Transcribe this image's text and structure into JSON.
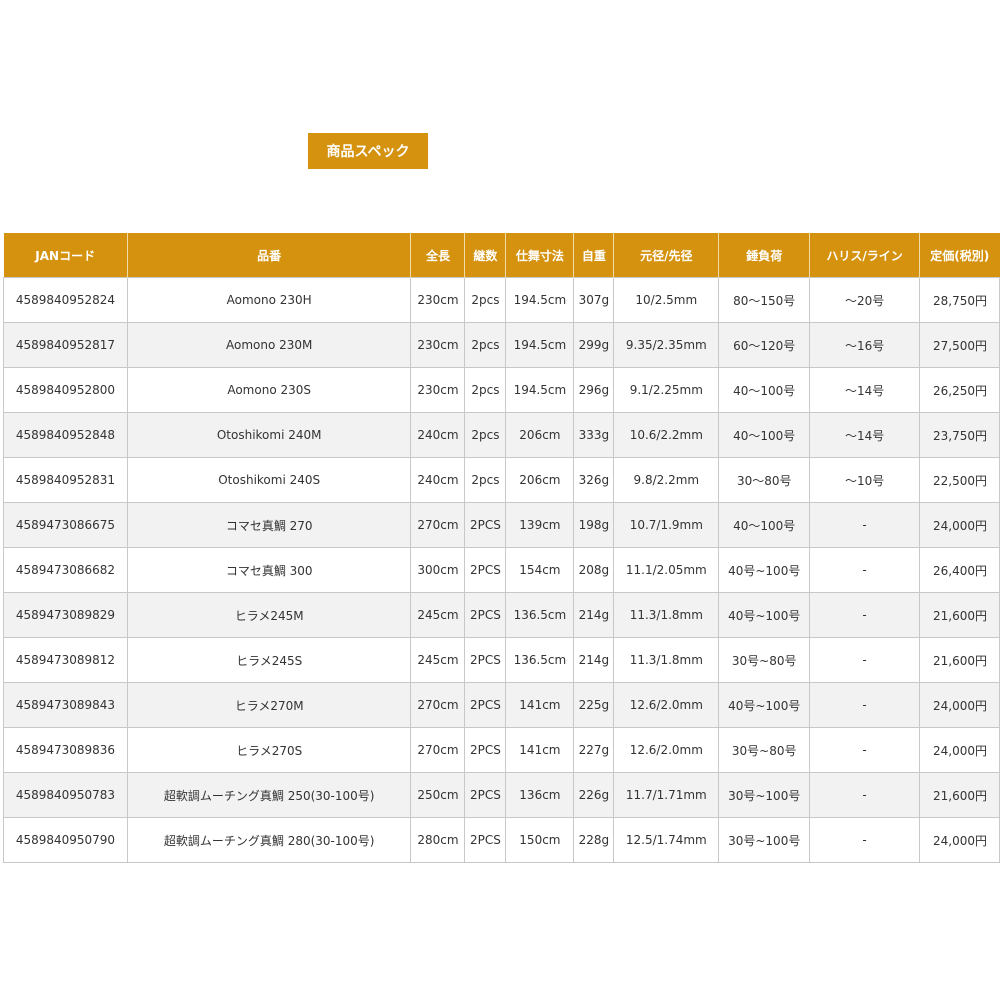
{
  "spec_title": "商品スペック",
  "colors": {
    "accent": "#d4920f",
    "row_alt": "#f2f2f2",
    "border": "#c8c8c8"
  },
  "table": {
    "headers": [
      "JANコード",
      "品番",
      "全長",
      "継数",
      "仕舞寸法",
      "自重",
      "元径/先径",
      "錘負荷",
      "ハリス/ライン",
      "定価(税別)"
    ],
    "rows": [
      [
        "4589840952824",
        "Aomono 230H",
        "230cm",
        "2pcs",
        "194.5cm",
        "307g",
        "10/2.5mm",
        "80～150号",
        "～20号",
        "28,750円"
      ],
      [
        "4589840952817",
        "Aomono 230M",
        "230cm",
        "2pcs",
        "194.5cm",
        "299g",
        "9.35/2.35mm",
        "60～120号",
        "～16号",
        "27,500円"
      ],
      [
        "4589840952800",
        "Aomono 230S",
        "230cm",
        "2pcs",
        "194.5cm",
        "296g",
        "9.1/2.25mm",
        "40～100号",
        "～14号",
        "26,250円"
      ],
      [
        "4589840952848",
        "Otoshikomi 240M",
        "240cm",
        "2pcs",
        "206cm",
        "333g",
        "10.6/2.2mm",
        "40～100号",
        "～14号",
        "23,750円"
      ],
      [
        "4589840952831",
        "Otoshikomi 240S",
        "240cm",
        "2pcs",
        "206cm",
        "326g",
        "9.8/2.2mm",
        "30～80号",
        "～10号",
        "22,500円"
      ],
      [
        "4589473086675",
        "コマセ真鯛 270",
        "270cm",
        "2PCS",
        "139cm",
        "198g",
        "10.7/1.9mm",
        "40～100号",
        "-",
        "24,000円"
      ],
      [
        "4589473086682",
        "コマセ真鯛 300",
        "300cm",
        "2PCS",
        "154cm",
        "208g",
        "11.1/2.05mm",
        "40号~100号",
        "-",
        "26,400円"
      ],
      [
        "4589473089829",
        "ヒラメ245M",
        "245cm",
        "2PCS",
        "136.5cm",
        "214g",
        "11.3/1.8mm",
        "40号~100号",
        "-",
        "21,600円"
      ],
      [
        "4589473089812",
        "ヒラメ245S",
        "245cm",
        "2PCS",
        "136.5cm",
        "214g",
        "11.3/1.8mm",
        "30号~80号",
        "-",
        "21,600円"
      ],
      [
        "4589473089843",
        "ヒラメ270M",
        "270cm",
        "2PCS",
        "141cm",
        "225g",
        "12.6/2.0mm",
        "40号~100号",
        "-",
        "24,000円"
      ],
      [
        "4589473089836",
        "ヒラメ270S",
        "270cm",
        "2PCS",
        "141cm",
        "227g",
        "12.6/2.0mm",
        "30号~80号",
        "-",
        "24,000円"
      ],
      [
        "4589840950783",
        "超軟調ムーチング真鯛 250(30-100号)",
        "250cm",
        "2PCS",
        "136cm",
        "226g",
        "11.7/1.71mm",
        "30号~100号",
        "-",
        "21,600円"
      ],
      [
        "4589840950790",
        "超軟調ムーチング真鯛 280(30-100号)",
        "280cm",
        "2PCS",
        "150cm",
        "228g",
        "12.5/1.74mm",
        "30号~100号",
        "-",
        "24,000円"
      ]
    ]
  }
}
